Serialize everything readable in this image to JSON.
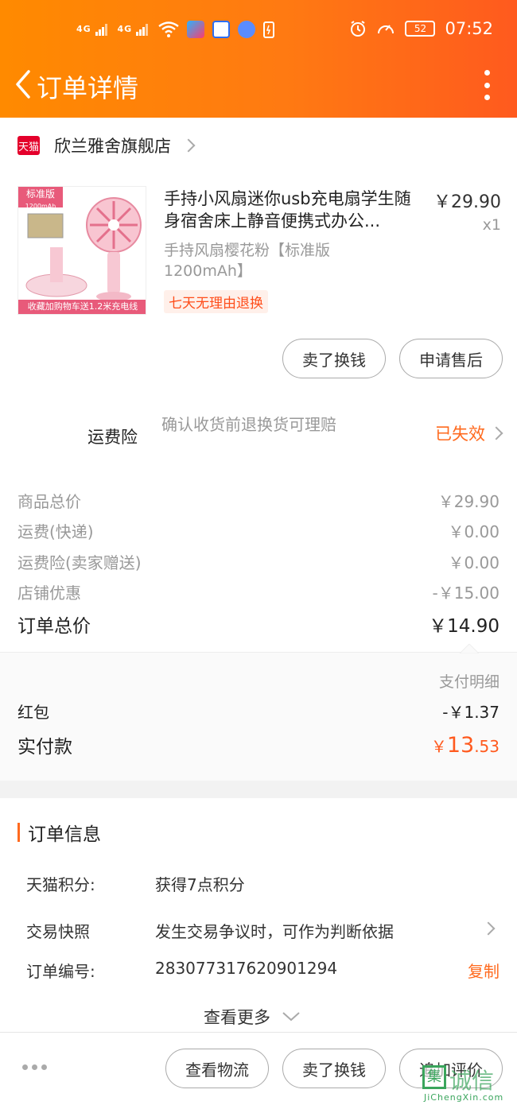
{
  "status_bar": {
    "signal_1": "4G",
    "signal_2": "4G",
    "battery": "52",
    "time": "07:52",
    "icons": [
      "wifi-icon",
      "youku-app-icon",
      "baidu-app-icon",
      "music-app-icon",
      "battery-saver-icon",
      "alarm-icon",
      "speedometer-icon"
    ]
  },
  "header": {
    "title": "订单详情",
    "back_icon": "chevron-left-icon",
    "menu_icon": "more-vertical-icon"
  },
  "store": {
    "badge": "天猫",
    "name": "欣兰雅舍旗舰店"
  },
  "product": {
    "title": "手持小风扇迷你usb充电扇学生随身宿舍床上静音便携式办公...",
    "price": "￥29.90",
    "quantity": "x1",
    "spec": "手持风扇樱花粉【标准版1200mAh】",
    "image_tag": "标准版",
    "image_tag_sub": "1200mAh",
    "image_banner": "收藏加购物车送1.2米充电线",
    "refund_policy": "七天无理由退换"
  },
  "product_actions": {
    "sell_label": "卖了换钱",
    "aftersale_label": "申请售后"
  },
  "insurance": {
    "label": "运费险",
    "description": "确认收货前退换货可理赔",
    "status": "已失效"
  },
  "summary": {
    "rows": [
      {
        "label": "商品总价",
        "value": "￥29.90"
      },
      {
        "label": "运费(快递)",
        "value": "￥0.00"
      },
      {
        "label": "运费险(卖家赠送)",
        "value": "￥0.00"
      },
      {
        "label": "店铺优惠",
        "value": "-￥15.00"
      }
    ],
    "total_label": "订单总价",
    "total_value": "￥14.90"
  },
  "payment": {
    "detail_label": "支付明细",
    "redpacket_label": "红包",
    "redpacket_value": "-￥1.37",
    "paid_label": "实付款",
    "paid_currency": "￥",
    "paid_int": "13",
    "paid_dec": ".53"
  },
  "order_info": {
    "title": "订单信息",
    "points_label": "天猫积分:",
    "points_value": "获得7点积分",
    "snapshot_label": "交易快照",
    "snapshot_value": "发生交易争议时，可作为判断依据",
    "order_no_label": "订单编号:",
    "order_no_value": "283077317620901294",
    "copy_label": "复制",
    "more_label": "查看更多"
  },
  "bottom_bar": {
    "logistics_label": "查看物流",
    "sell_label": "卖了换钱",
    "review_label": "追加评价"
  },
  "watermark": {
    "mark": "集",
    "big": "诚信",
    "small": "JiChengXin.com"
  },
  "colors": {
    "header_start": "#ff8a00",
    "header_end": "#ff5a1e",
    "accent": "#ff6a1e",
    "tmall_red": "#e4002b"
  }
}
